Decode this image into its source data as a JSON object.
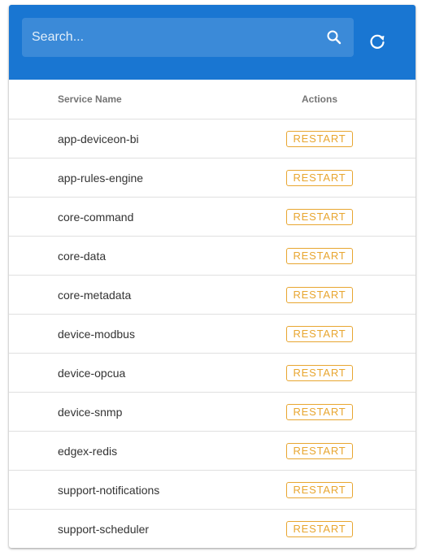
{
  "search": {
    "placeholder": "Search..."
  },
  "table": {
    "headers": {
      "name": "Service Name",
      "actions": "Actions"
    },
    "rows": [
      {
        "name": "app-deviceon-bi",
        "action": "RESTART"
      },
      {
        "name": "app-rules-engine",
        "action": "RESTART"
      },
      {
        "name": "core-command",
        "action": "RESTART"
      },
      {
        "name": "core-data",
        "action": "RESTART"
      },
      {
        "name": "core-metadata",
        "action": "RESTART"
      },
      {
        "name": "device-modbus",
        "action": "RESTART"
      },
      {
        "name": "device-opcua",
        "action": "RESTART"
      },
      {
        "name": "device-snmp",
        "action": "RESTART"
      },
      {
        "name": "edgex-redis",
        "action": "RESTART"
      },
      {
        "name": "support-notifications",
        "action": "RESTART"
      },
      {
        "name": "support-scheduler",
        "action": "RESTART"
      }
    ]
  },
  "icons": {
    "search": "search-icon",
    "refresh": "refresh-icon"
  },
  "colors": {
    "header": "#1976d2",
    "restart": "#e8a630"
  }
}
